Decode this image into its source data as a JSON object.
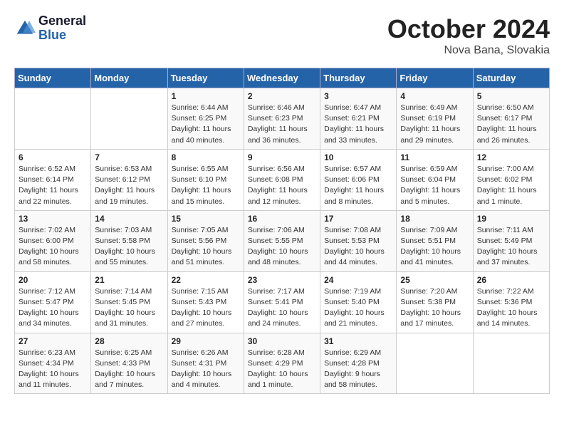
{
  "header": {
    "logo_line1": "General",
    "logo_line2": "Blue",
    "title": "October 2024",
    "subtitle": "Nova Bana, Slovakia"
  },
  "days_of_week": [
    "Sunday",
    "Monday",
    "Tuesday",
    "Wednesday",
    "Thursday",
    "Friday",
    "Saturday"
  ],
  "weeks": [
    [
      {
        "day": "",
        "info": ""
      },
      {
        "day": "",
        "info": ""
      },
      {
        "day": "1",
        "info": "Sunrise: 6:44 AM\nSunset: 6:25 PM\nDaylight: 11 hours and 40 minutes."
      },
      {
        "day": "2",
        "info": "Sunrise: 6:46 AM\nSunset: 6:23 PM\nDaylight: 11 hours and 36 minutes."
      },
      {
        "day": "3",
        "info": "Sunrise: 6:47 AM\nSunset: 6:21 PM\nDaylight: 11 hours and 33 minutes."
      },
      {
        "day": "4",
        "info": "Sunrise: 6:49 AM\nSunset: 6:19 PM\nDaylight: 11 hours and 29 minutes."
      },
      {
        "day": "5",
        "info": "Sunrise: 6:50 AM\nSunset: 6:17 PM\nDaylight: 11 hours and 26 minutes."
      }
    ],
    [
      {
        "day": "6",
        "info": "Sunrise: 6:52 AM\nSunset: 6:14 PM\nDaylight: 11 hours and 22 minutes."
      },
      {
        "day": "7",
        "info": "Sunrise: 6:53 AM\nSunset: 6:12 PM\nDaylight: 11 hours and 19 minutes."
      },
      {
        "day": "8",
        "info": "Sunrise: 6:55 AM\nSunset: 6:10 PM\nDaylight: 11 hours and 15 minutes."
      },
      {
        "day": "9",
        "info": "Sunrise: 6:56 AM\nSunset: 6:08 PM\nDaylight: 11 hours and 12 minutes."
      },
      {
        "day": "10",
        "info": "Sunrise: 6:57 AM\nSunset: 6:06 PM\nDaylight: 11 hours and 8 minutes."
      },
      {
        "day": "11",
        "info": "Sunrise: 6:59 AM\nSunset: 6:04 PM\nDaylight: 11 hours and 5 minutes."
      },
      {
        "day": "12",
        "info": "Sunrise: 7:00 AM\nSunset: 6:02 PM\nDaylight: 11 hours and 1 minute."
      }
    ],
    [
      {
        "day": "13",
        "info": "Sunrise: 7:02 AM\nSunset: 6:00 PM\nDaylight: 10 hours and 58 minutes."
      },
      {
        "day": "14",
        "info": "Sunrise: 7:03 AM\nSunset: 5:58 PM\nDaylight: 10 hours and 55 minutes."
      },
      {
        "day": "15",
        "info": "Sunrise: 7:05 AM\nSunset: 5:56 PM\nDaylight: 10 hours and 51 minutes."
      },
      {
        "day": "16",
        "info": "Sunrise: 7:06 AM\nSunset: 5:55 PM\nDaylight: 10 hours and 48 minutes."
      },
      {
        "day": "17",
        "info": "Sunrise: 7:08 AM\nSunset: 5:53 PM\nDaylight: 10 hours and 44 minutes."
      },
      {
        "day": "18",
        "info": "Sunrise: 7:09 AM\nSunset: 5:51 PM\nDaylight: 10 hours and 41 minutes."
      },
      {
        "day": "19",
        "info": "Sunrise: 7:11 AM\nSunset: 5:49 PM\nDaylight: 10 hours and 37 minutes."
      }
    ],
    [
      {
        "day": "20",
        "info": "Sunrise: 7:12 AM\nSunset: 5:47 PM\nDaylight: 10 hours and 34 minutes."
      },
      {
        "day": "21",
        "info": "Sunrise: 7:14 AM\nSunset: 5:45 PM\nDaylight: 10 hours and 31 minutes."
      },
      {
        "day": "22",
        "info": "Sunrise: 7:15 AM\nSunset: 5:43 PM\nDaylight: 10 hours and 27 minutes."
      },
      {
        "day": "23",
        "info": "Sunrise: 7:17 AM\nSunset: 5:41 PM\nDaylight: 10 hours and 24 minutes."
      },
      {
        "day": "24",
        "info": "Sunrise: 7:19 AM\nSunset: 5:40 PM\nDaylight: 10 hours and 21 minutes."
      },
      {
        "day": "25",
        "info": "Sunrise: 7:20 AM\nSunset: 5:38 PM\nDaylight: 10 hours and 17 minutes."
      },
      {
        "day": "26",
        "info": "Sunrise: 7:22 AM\nSunset: 5:36 PM\nDaylight: 10 hours and 14 minutes."
      }
    ],
    [
      {
        "day": "27",
        "info": "Sunrise: 6:23 AM\nSunset: 4:34 PM\nDaylight: 10 hours and 11 minutes."
      },
      {
        "day": "28",
        "info": "Sunrise: 6:25 AM\nSunset: 4:33 PM\nDaylight: 10 hours and 7 minutes."
      },
      {
        "day": "29",
        "info": "Sunrise: 6:26 AM\nSunset: 4:31 PM\nDaylight: 10 hours and 4 minutes."
      },
      {
        "day": "30",
        "info": "Sunrise: 6:28 AM\nSunset: 4:29 PM\nDaylight: 10 hours and 1 minute."
      },
      {
        "day": "31",
        "info": "Sunrise: 6:29 AM\nSunset: 4:28 PM\nDaylight: 9 hours and 58 minutes."
      },
      {
        "day": "",
        "info": ""
      },
      {
        "day": "",
        "info": ""
      }
    ]
  ]
}
